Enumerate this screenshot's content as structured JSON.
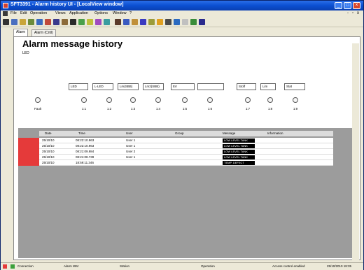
{
  "window": {
    "title": "SFT3391 - Alarm history UI - [LocalView window]"
  },
  "menu": [
    "File",
    "Edit",
    "Operation",
    "Views",
    "Application",
    "Options",
    "Window",
    "?"
  ],
  "tabs": [
    {
      "label": "Alarm"
    },
    {
      "label": "Alarm (Cntl)"
    }
  ],
  "page": {
    "heading": "Alarm message history",
    "sublabel": "LED"
  },
  "selectors": [
    {
      "label": "LED",
      "value": "1:1"
    },
    {
      "label": "L-LED",
      "value": "1:2"
    },
    {
      "label": "Lm(SBB)",
      "value": "1:3"
    },
    {
      "label": "Lm2(SBB)",
      "value": "1:4"
    },
    {
      "label": "Err",
      "value": "1:5"
    },
    {
      "label": "",
      "value": "1:6"
    },
    {
      "label": "Stoff",
      "value": "1:7"
    },
    {
      "label": "Lim",
      "value": "1:8"
    },
    {
      "label": "Stat",
      "value": "1:9"
    }
  ],
  "first_radio_label": "Fault",
  "table": {
    "headers": [
      "Date",
      "Time",
      "User",
      "Group",
      "Message",
      "Information"
    ],
    "rows": [
      {
        "date": "25/10/10",
        "time": "08:22:10.963",
        "user": "User 1",
        "group": "",
        "message": "LOW LEVEL TANK"
      },
      {
        "date": "25/10/10",
        "time": "08:22:10.963",
        "user": "User 1",
        "group": "",
        "message": "LOW LEVEL TANK"
      },
      {
        "date": "25/10/10",
        "time": "08:21:09.984",
        "user": "User 2",
        "group": "",
        "message": "LOW LEVEL TANK"
      },
      {
        "date": "25/10/10",
        "time": "08:21:08.739",
        "user": "User 1",
        "group": "",
        "message": "LOW LEVEL TANK"
      },
      {
        "date": "25/10/10",
        "time": "18:59:11.346",
        "user": "",
        "group": "",
        "message": "TEMP. DEFECT"
      }
    ]
  },
  "status": {
    "connection": "Connection",
    "alarm": "Alarm WM",
    "station": "Station",
    "state": "Operation",
    "mode": "Access control enabled",
    "datetime": "25/10/2010 18:35"
  },
  "colors": {
    "title_bar": "#0b4fd1",
    "selection_red": "#e53a3a",
    "message_black": "#000000",
    "table_bg": "#9c9c9c"
  }
}
